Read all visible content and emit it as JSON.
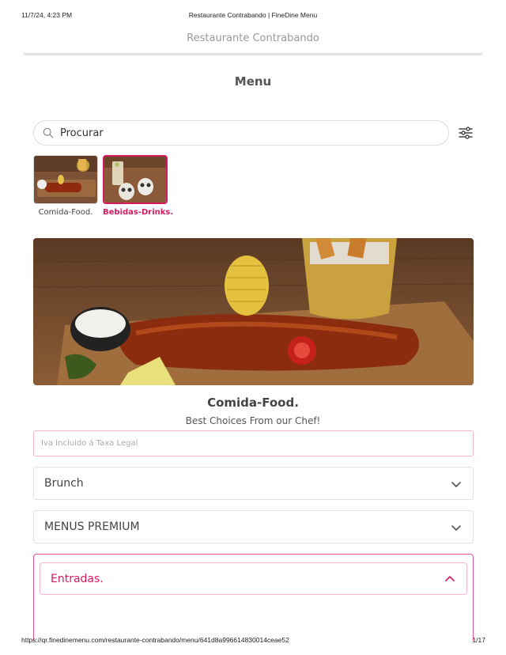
{
  "print_header": {
    "datetime": "11/7/24, 4:23 PM",
    "page_title": "Restaurante Contrabando | FineDine Menu"
  },
  "restaurant": {
    "name": "Restaurante Contrabando"
  },
  "menu": {
    "title": "Menu"
  },
  "search": {
    "placeholder": "Procurar"
  },
  "icons": {
    "search": "search-icon",
    "filter": "filter-sliders-icon",
    "chevron_down": "chevron-down-icon",
    "chevron_up": "chevron-up-icon"
  },
  "categories": [
    {
      "label": "Comida-Food.",
      "active": false
    },
    {
      "label": "Bebidas-Drinks.",
      "active": true
    }
  ],
  "section": {
    "title": "Comida-Food.",
    "subtitle": "Best Choices From our Chef!",
    "tax_note": "Iva Incluido á Taxa Legal"
  },
  "accordions": [
    {
      "label": "Brunch",
      "expanded": false
    },
    {
      "label": "MENUS PREMIUM",
      "expanded": false
    },
    {
      "label": "Entradas.",
      "expanded": true
    }
  ],
  "print_footer": {
    "url": "https://qr.finedinemenu.com/restaurante-contrabando/menu/641d8a996614830014ceae52",
    "page": "1/17"
  },
  "colors": {
    "accent": "#d81b60",
    "accent_border": "#e8588c",
    "muted_text": "#9a9a9a",
    "border": "#e2e2e2"
  }
}
